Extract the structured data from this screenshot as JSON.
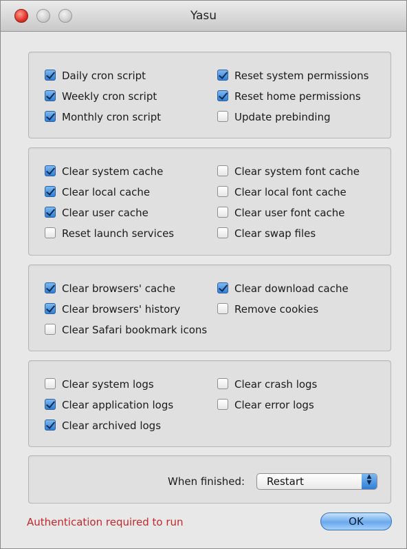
{
  "window": {
    "title": "Yasu"
  },
  "groups": [
    {
      "name": "cron",
      "items": [
        {
          "label": "Daily cron script",
          "checked": true
        },
        {
          "label": "Weekly cron script",
          "checked": true
        },
        {
          "label": "Monthly cron script",
          "checked": true
        },
        {
          "label": "Reset system permissions",
          "checked": true
        },
        {
          "label": "Reset home permissions",
          "checked": true
        },
        {
          "label": "Update prebinding",
          "checked": false
        }
      ]
    },
    {
      "name": "caches",
      "items": [
        {
          "label": "Clear system cache",
          "checked": true
        },
        {
          "label": "Clear local cache",
          "checked": true
        },
        {
          "label": "Clear user cache",
          "checked": true
        },
        {
          "label": "Reset launch services",
          "checked": false
        },
        {
          "label": "Clear system font cache",
          "checked": false
        },
        {
          "label": "Clear local font cache",
          "checked": false
        },
        {
          "label": "Clear user font cache",
          "checked": false
        },
        {
          "label": "Clear swap files",
          "checked": false
        }
      ]
    },
    {
      "name": "browsers",
      "items": [
        {
          "label": "Clear browsers' cache",
          "checked": true
        },
        {
          "label": "Clear browsers' history",
          "checked": true
        },
        {
          "label": "Clear Safari bookmark icons",
          "checked": false
        },
        {
          "label": "Clear download cache",
          "checked": true
        },
        {
          "label": "Remove cookies",
          "checked": false
        }
      ]
    },
    {
      "name": "logs",
      "items": [
        {
          "label": "Clear system logs",
          "checked": false
        },
        {
          "label": "Clear application logs",
          "checked": true
        },
        {
          "label": "Clear archived logs",
          "checked": true
        },
        {
          "label": "Clear crash logs",
          "checked": false
        },
        {
          "label": "Clear error logs",
          "checked": false
        }
      ]
    }
  ],
  "finish": {
    "label": "When finished:",
    "selected": "Restart"
  },
  "status": {
    "message": "Authentication required to run"
  },
  "ok_button": {
    "label": "OK"
  },
  "colors": {
    "accent": "#2f7fd6",
    "error_text": "#c3262b"
  }
}
